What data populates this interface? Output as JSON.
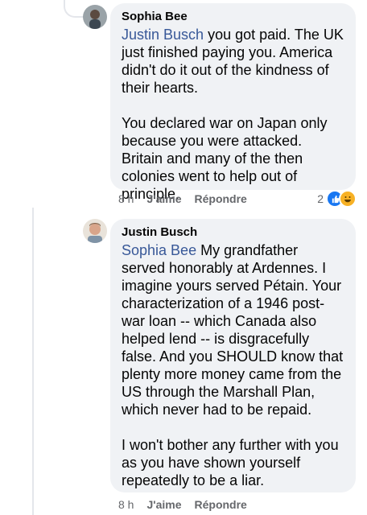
{
  "comments": [
    {
      "author": "Sophia Bee",
      "mention": "Justin Busch",
      "text": " you got paid. The UK just finished paying you. America didn't do it out of the kindness of their hearts.\n\nYou declared war on Japan only because you were attacked. Britain and many of the then colonies went to help out of principle.",
      "time": "8 h",
      "like_label": "J'aime",
      "reply_label": "Répondre",
      "reaction_count": "2"
    },
    {
      "author": "Justin Busch",
      "mention": "Sophia Bee",
      "text": " My grandfather served honorably at Ardennes. I imagine yours served Pétain. Your characterization of a 1946 post-war loan -- which Canada also helped lend -- is disgracefully false. And you SHOULD know that plenty more money came from the US through the Marshall Plan, which never had to be repaid.\n\nI won't bother any further with you as you have shown yourself repeatedly to be a liar.",
      "time": "8 h",
      "like_label": "J'aime",
      "reply_label": "Répondre"
    }
  ],
  "colors": {
    "mention": "#385898",
    "bubble": "#f0f2f5",
    "like": "#1877f2",
    "haha": "#f7b125"
  },
  "icons": [
    "like-reaction-icon",
    "haha-reaction-icon"
  ]
}
